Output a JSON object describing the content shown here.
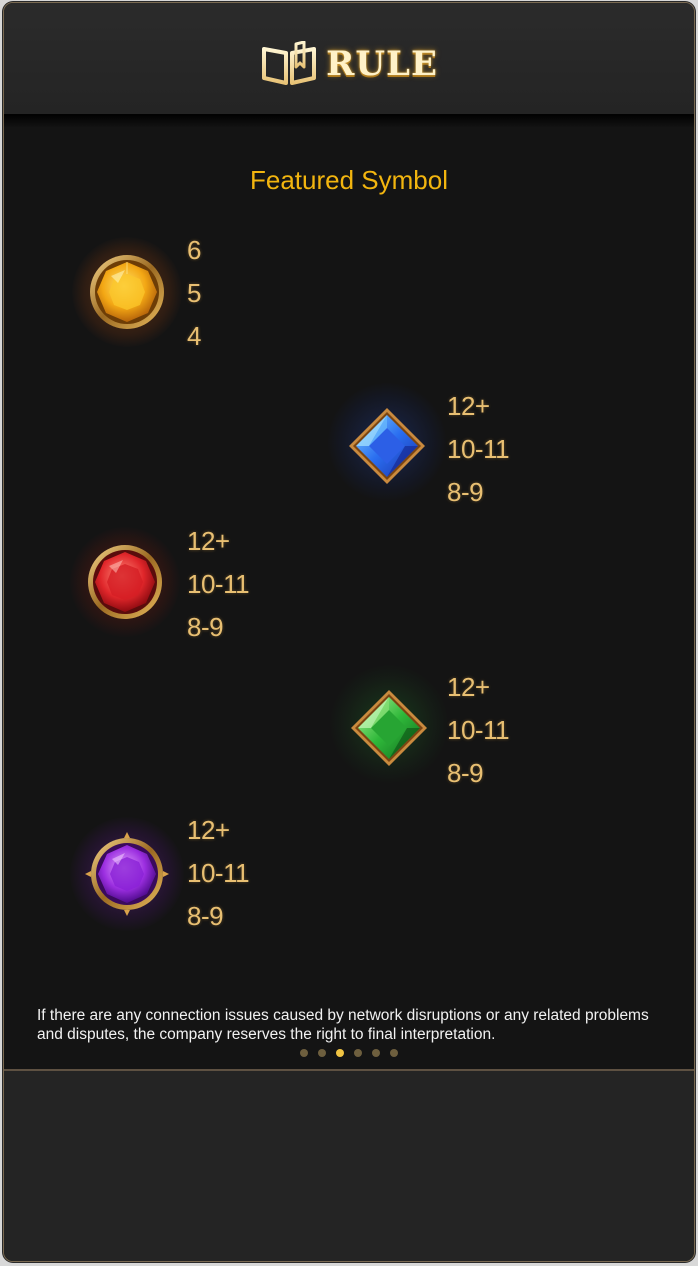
{
  "header": {
    "title": "RULE",
    "icon": "open-book-icon"
  },
  "section": {
    "title": "Featured Symbol"
  },
  "symbols": [
    {
      "name": "yellow-gem-icon",
      "color": "#f5b018",
      "payouts": [
        "6",
        "5",
        "4"
      ]
    },
    {
      "name": "blue-gem-icon",
      "color": "#2b6ee8",
      "payouts": [
        "12+",
        "10-11",
        "8-9"
      ]
    },
    {
      "name": "red-gem-icon",
      "color": "#e0262a",
      "payouts": [
        "12+",
        "10-11",
        "8-9"
      ]
    },
    {
      "name": "green-gem-icon",
      "color": "#2fb83a",
      "payouts": [
        "12+",
        "10-11",
        "8-9"
      ]
    },
    {
      "name": "purple-gem-icon",
      "color": "#9b2ee0",
      "payouts": [
        "12+",
        "10-11",
        "8-9"
      ]
    }
  ],
  "disclaimer": "If there are any connection issues caused by network disruptions or any related problems and disputes, the company reserves the right to final interpretation.",
  "pagination": {
    "total": 6,
    "active_index": 2
  },
  "colors": {
    "accent": "#f2b50f",
    "payout_text": "#e8bf72",
    "background": "#141414"
  }
}
